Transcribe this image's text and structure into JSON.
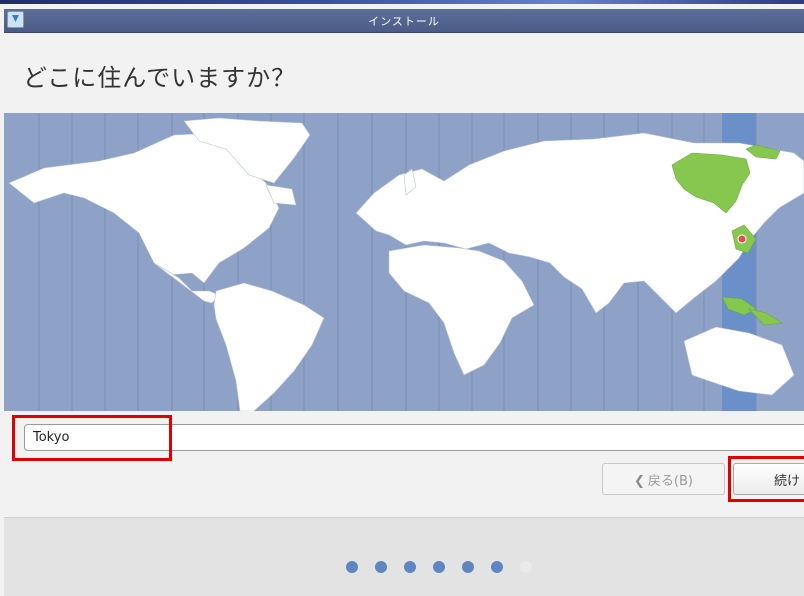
{
  "window": {
    "title": "インストール"
  },
  "page": {
    "heading": "どこに住んでいますか？"
  },
  "timezone": {
    "value": "Tokyo",
    "selected_zone_offset": "UTC+9"
  },
  "buttons": {
    "back_label": "戻る(B)",
    "continue_label": "続け"
  },
  "progress": {
    "total_steps": 7,
    "completed_steps": 6
  },
  "icons": {
    "back": "chevron-left-icon",
    "app": "installer-icon"
  },
  "colors": {
    "map_water": "#8ea1c7",
    "selected_zone": "#6b8fc9",
    "highlight_land": "#86c84f",
    "step_done": "#5f86c1"
  }
}
